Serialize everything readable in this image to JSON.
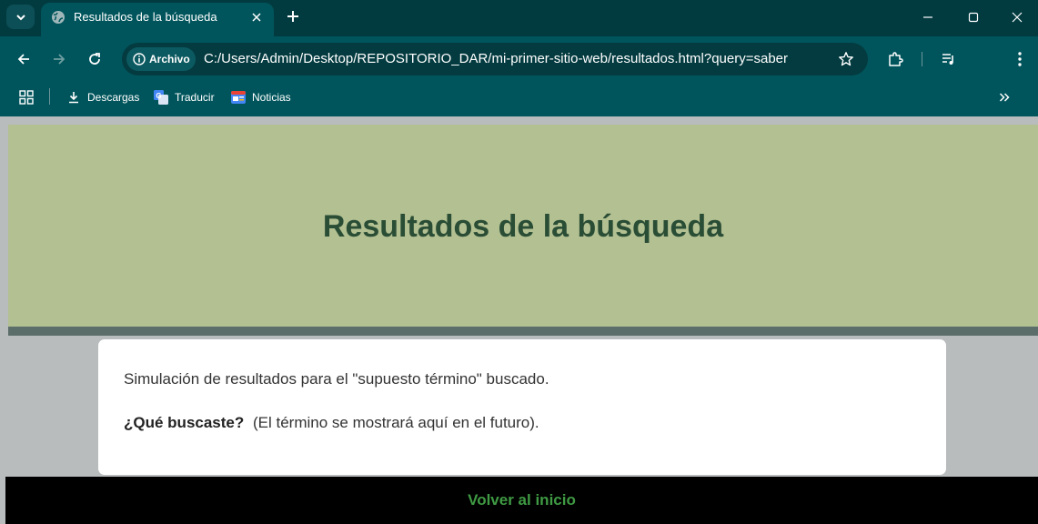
{
  "tab": {
    "title": "Resultados de la búsqueda"
  },
  "omnibox": {
    "chip_label": "Archivo",
    "url": "C:/Users/Admin/Desktop/REPOSITORIO_DAR/mi-primer-sitio-web/resultados.html?query=saber"
  },
  "bookmarks": [
    {
      "label": "Descargas",
      "icon": "download-icon"
    },
    {
      "label": "Traducir",
      "icon": "translate-icon"
    },
    {
      "label": "Noticias",
      "icon": "news-icon"
    }
  ],
  "page": {
    "heading": "Resultados de la búsqueda",
    "line1": "Simulación de resultados para el \"supuesto término\" buscado.",
    "question_bold": "¿Qué buscaste?",
    "question_rest": "(El término se mostrará aquí en el futuro).",
    "footer_link": "Volver al inicio"
  },
  "colors": {
    "chrome_dark": "#013b40",
    "chrome": "#00555c",
    "hero_bg": "#b3c092",
    "heading": "#2a4d35",
    "link": "#3f9a43"
  }
}
